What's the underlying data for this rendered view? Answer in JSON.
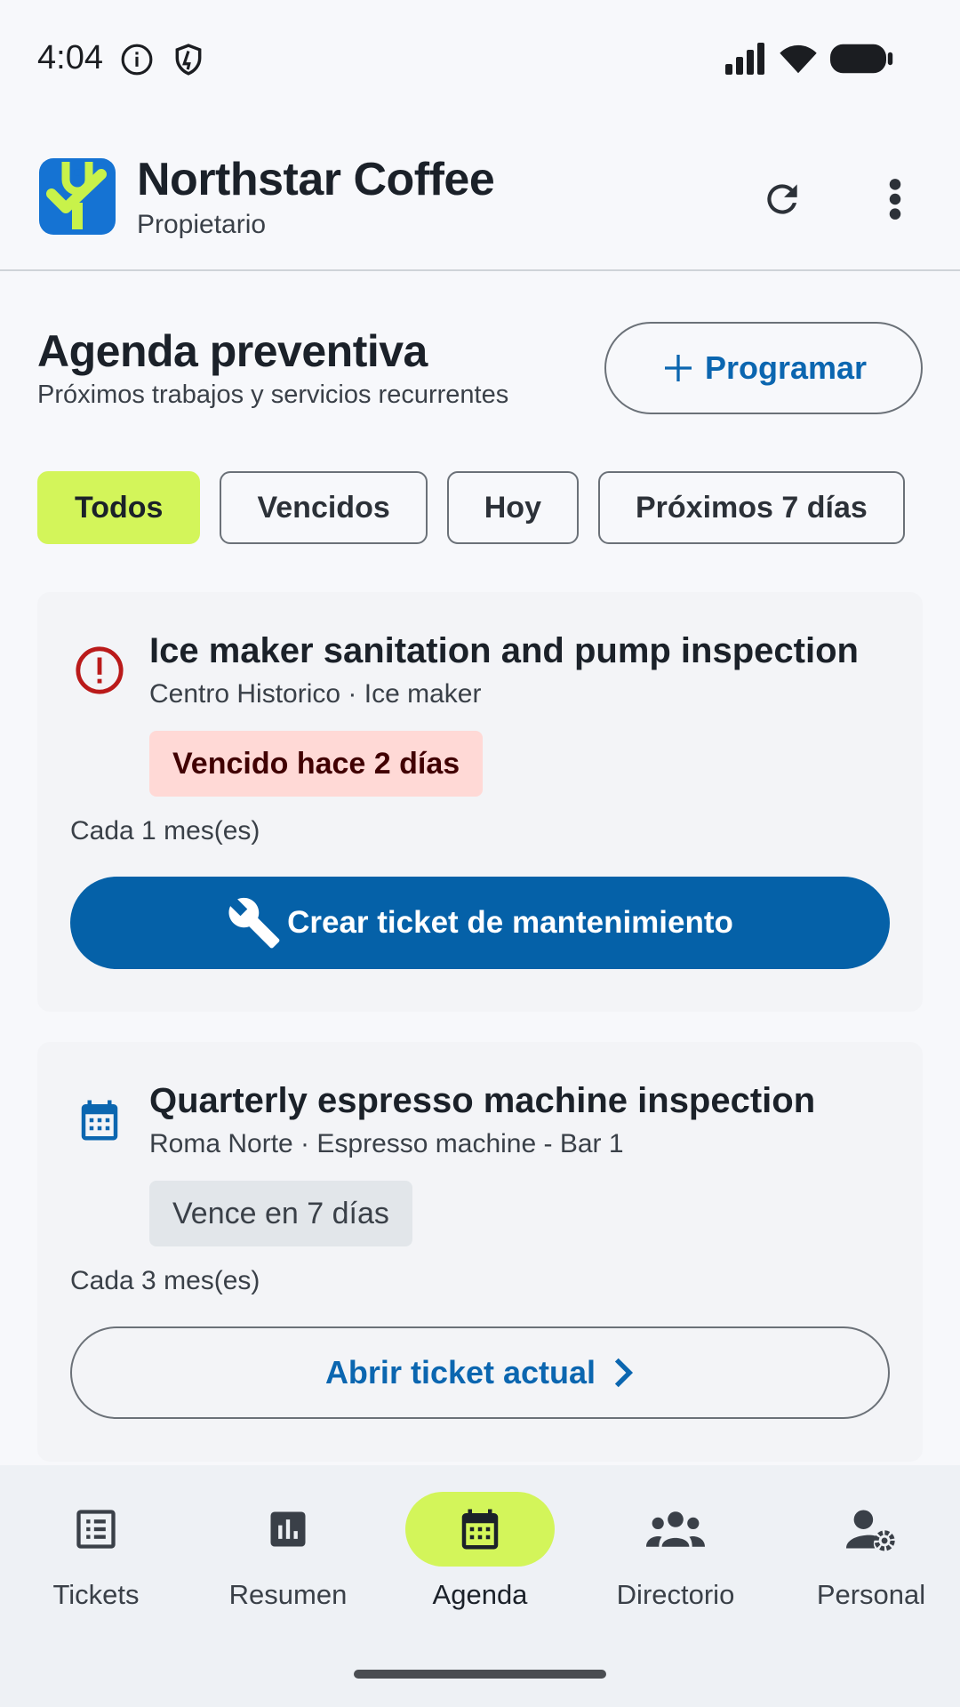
{
  "status_bar": {
    "time": "4:04",
    "icons": [
      "info-icon",
      "shield-icon",
      "signal-icon",
      "wifi-icon",
      "battery-icon"
    ]
  },
  "app_bar": {
    "title": "Northstar Coffee",
    "subtitle": "Propietario",
    "actions": [
      "refresh-icon",
      "more-vert-icon"
    ]
  },
  "section": {
    "title": "Agenda preventiva",
    "subtitle": "Próximos trabajos y servicios recurrentes",
    "schedule_label": "Programar"
  },
  "filters": [
    {
      "label": "Todos",
      "active": true
    },
    {
      "label": "Vencidos",
      "active": false
    },
    {
      "label": "Hoy",
      "active": false
    },
    {
      "label": "Próximos 7 días",
      "active": false
    }
  ],
  "cards": [
    {
      "icon": "error-icon",
      "title": "Ice maker sanitation and pump inspection",
      "meta": "Centro Historico · Ice maker",
      "badge": "Vencido hace 2 días",
      "recurrence": "Cada 1 mes(es)",
      "action_label": "Crear ticket de mantenimiento",
      "action_icon": "wrench-icon"
    },
    {
      "icon": "calendar-icon",
      "title": "Quarterly espresso machine inspection",
      "meta": "Roma Norte · Espresso machine - Bar 1",
      "badge": "Vence en 7 días",
      "recurrence": "Cada 3 mes(es)",
      "action_label": "Abrir ticket actual",
      "action_icon": "chevron-right-icon"
    }
  ],
  "bottom_nav": [
    {
      "label": "Tickets",
      "icon": "list-alt-icon",
      "active": false
    },
    {
      "label": "Resumen",
      "icon": "bar-chart-icon",
      "active": false
    },
    {
      "label": "Agenda",
      "icon": "calendar-icon",
      "active": true
    },
    {
      "label": "Directorio",
      "icon": "group-icon",
      "active": false
    },
    {
      "label": "Personal",
      "icon": "manage-accounts-icon",
      "active": false
    }
  ],
  "colors": {
    "accent": "#d3f55a",
    "primary": "#0561a8",
    "link": "#0b66b0",
    "error": "#ba1a1a",
    "overdue_bg": "#ffd9d6"
  }
}
